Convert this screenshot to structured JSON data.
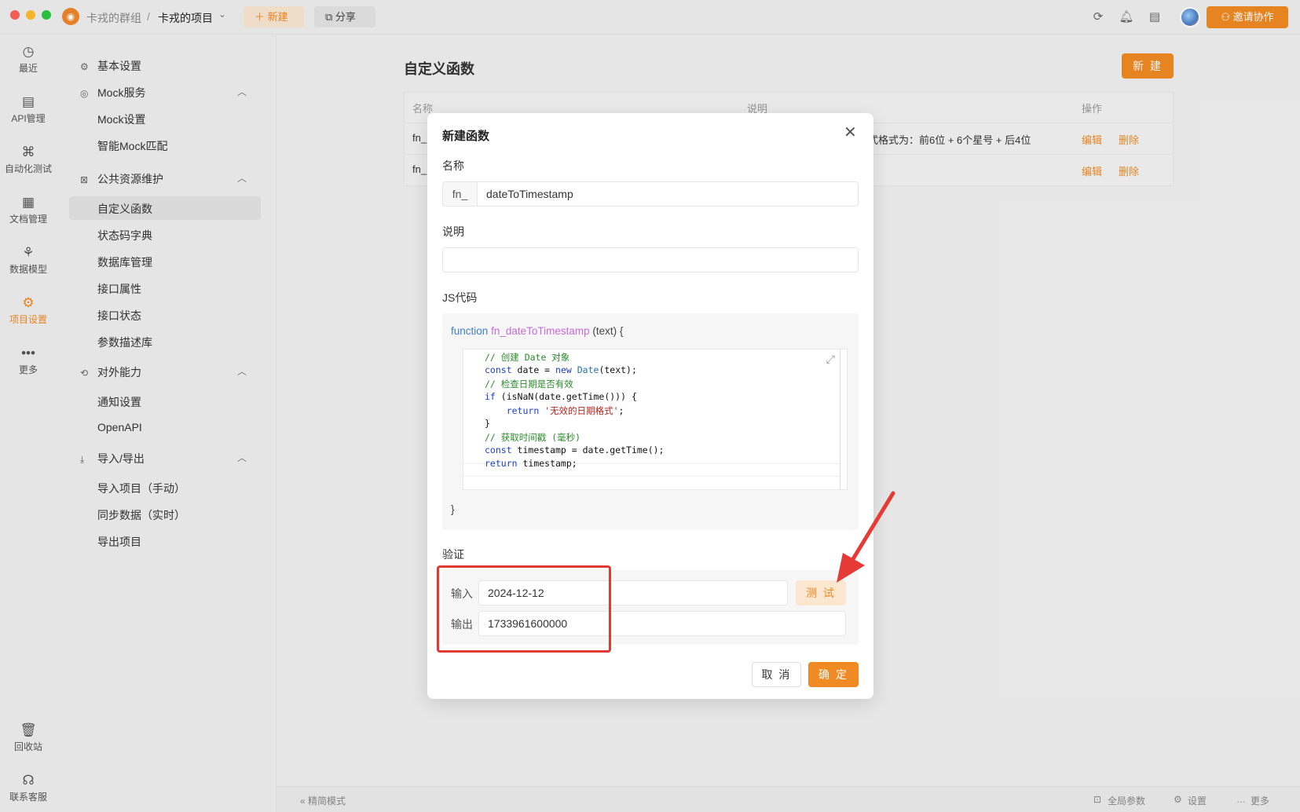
{
  "titlebar": {
    "group": "卡戎的群组",
    "separator": "/",
    "project": "卡戎的项目",
    "chevron": "⌄",
    "new_label": "＋ 新建",
    "share_label": "⧉ 分享",
    "invite_label": "⚇ 邀请协作",
    "icons": [
      "refresh-icon",
      "bell-icon",
      "notes-icon"
    ]
  },
  "rail": [
    {
      "label": "最近",
      "icon": "clock-icon",
      "glyph": "◷"
    },
    {
      "label": "API管理",
      "icon": "api-icon",
      "glyph": "▤"
    },
    {
      "label": "自动化测试",
      "icon": "automation-icon",
      "glyph": "⌘"
    },
    {
      "label": "文档管理",
      "icon": "document-icon",
      "glyph": "▦"
    },
    {
      "label": "数据模型",
      "icon": "model-icon",
      "glyph": "⚘"
    },
    {
      "label": "项目设置",
      "icon": "project-settings-icon",
      "glyph": "⚙"
    },
    {
      "label": "更多",
      "icon": "more-icon",
      "glyph": "•••"
    },
    {
      "label": "回收站",
      "icon": "trash-icon",
      "glyph": "🗑"
    },
    {
      "label": "联系客服",
      "icon": "headset-icon",
      "glyph": "☊"
    }
  ],
  "nav": {
    "basic": "基本设置",
    "mock": "Mock服务",
    "mock_settings": "Mock设置",
    "smart_mock": "智能Mock匹配",
    "public": "公共资源维护",
    "custom_fn": "自定义函数",
    "status_dict": "状态码字典",
    "db_mgmt": "数据库管理",
    "api_props": "接口属性",
    "api_status": "接口状态",
    "param_lib": "参数描述库",
    "external": "对外能力",
    "notify": "通知设置",
    "openapi": "OpenAPI",
    "import_export": "导入/导出",
    "import_manual": "导入项目（手动）",
    "sync_data": "同步数据（实时）",
    "export_project": "导出项目"
  },
  "main": {
    "title": "自定义函数",
    "new_button": "新 建",
    "columns": [
      "名称",
      "说明",
      "操作"
    ],
    "rows": [
      {
        "name": "fn_",
        "desc": "式格式为：前6位 + 6个星号 + 后4位",
        "edit": "编辑",
        "delete": "删除"
      },
      {
        "name": "fn_",
        "desc": "",
        "edit": "编辑",
        "delete": "删除"
      }
    ]
  },
  "modal": {
    "title": "新建函数",
    "close": "✕",
    "name_label": "名称",
    "name_prefix": "fn_",
    "name_value": "dateToTimestamp",
    "desc_label": "说明",
    "desc_value": "",
    "code_label": "JS代码",
    "sig_keyword": "function",
    "sig_name": "fn_dateToTimestamp",
    "sig_params": " (text) {",
    "close_brace": "}",
    "verify_label": "验证",
    "input_label": "输入",
    "input_value": "2024-12-12",
    "output_label": "输出",
    "output_value": "1733961600000",
    "test_button": "测 试",
    "cancel_button": "取 消",
    "ok_button": "确 定"
  },
  "code_lines": [
    {
      "parts": [
        [
          "c",
          "// 创建 Date 对象"
        ]
      ]
    },
    {
      "parts": [
        [
          "k",
          "const"
        ],
        [
          "t",
          " date = "
        ],
        [
          "k",
          "new"
        ],
        [
          "t",
          " "
        ],
        [
          "cls",
          "Date"
        ],
        [
          "t",
          "(text);"
        ]
      ]
    },
    {
      "parts": [
        [
          "c",
          "// 检查日期是否有效"
        ]
      ]
    },
    {
      "parts": [
        [
          "k",
          "if"
        ],
        [
          "t",
          " (isNaN(date.getTime())) {"
        ]
      ]
    },
    {
      "parts": [
        [
          "t",
          "    "
        ],
        [
          "k",
          "return"
        ],
        [
          "t",
          " "
        ],
        [
          "s",
          "'无效的日期格式'"
        ],
        [
          "t",
          ";"
        ]
      ]
    },
    {
      "parts": [
        [
          "t",
          "}"
        ]
      ]
    },
    {
      "parts": [
        [
          "c",
          "// 获取时间戳 (毫秒)"
        ]
      ]
    },
    {
      "parts": [
        [
          "k",
          "const"
        ],
        [
          "t",
          " timestamp = date.getTime();"
        ]
      ]
    },
    {
      "parts": [
        [
          "k",
          "return"
        ],
        [
          "t",
          " timestamp;"
        ]
      ]
    }
  ],
  "status": {
    "compact": "« 精简模式",
    "global_params": "全局参数",
    "settings": "设置",
    "more": "更多"
  },
  "colors": {
    "accent": "#f08a24",
    "highlight_box": "#e03a35"
  }
}
